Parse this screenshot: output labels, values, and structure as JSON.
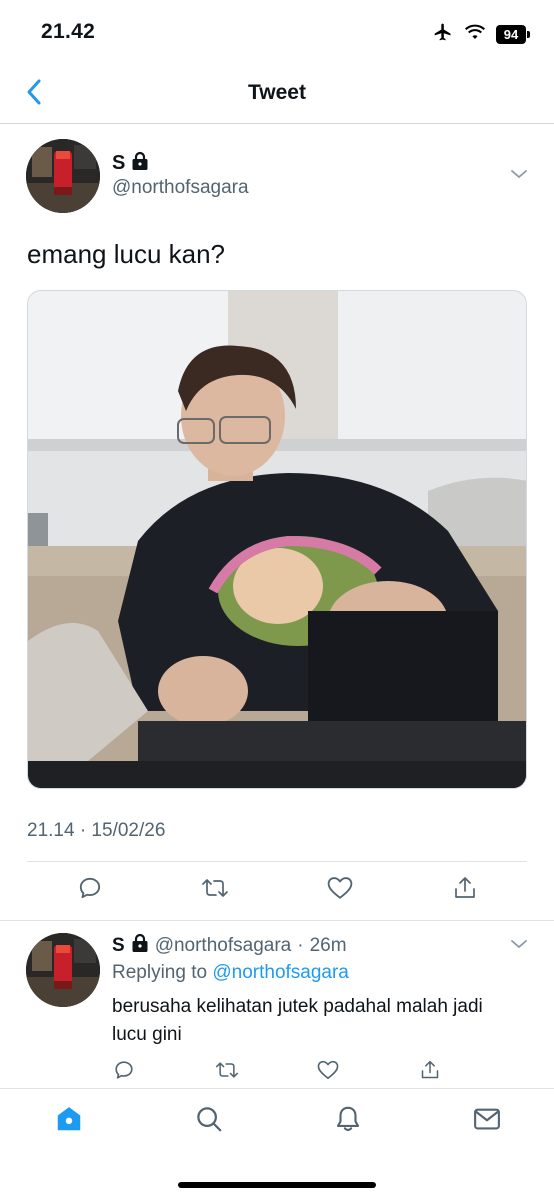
{
  "status_bar": {
    "time": "21.42",
    "battery": "94",
    "icons": [
      "airplane-icon",
      "wifi-icon",
      "battery-icon"
    ]
  },
  "header": {
    "title": "Tweet",
    "back_icon": "chevron-left-icon"
  },
  "tweet": {
    "author_name": "S",
    "author_handle": "@northofsagara",
    "protected_icon": "lock-icon",
    "text": "emang lucu kan?",
    "timestamp": "21.14 · 15/02/26",
    "actions": [
      "reply-icon",
      "retweet-icon",
      "like-icon",
      "share-icon"
    ]
  },
  "reply": {
    "author_name": "S",
    "author_handle": "@northofsagara",
    "separator": "·",
    "time": "26m",
    "replying_prefix": "Replying to",
    "replying_to": "@northofsagara",
    "text": "berusaha kelihatan jutek padahal malah jadi lucu gini",
    "actions": [
      "reply-icon",
      "retweet-icon",
      "like-icon",
      "share-icon"
    ]
  },
  "tab_bar": {
    "items": [
      "home-icon",
      "search-icon",
      "notifications-icon",
      "messages-icon"
    ],
    "active": "home-icon"
  },
  "colors": {
    "accent": "#1d9bf0",
    "text_primary": "#0f1419",
    "text_secondary": "#536471",
    "divider": "#dfe3e6"
  }
}
